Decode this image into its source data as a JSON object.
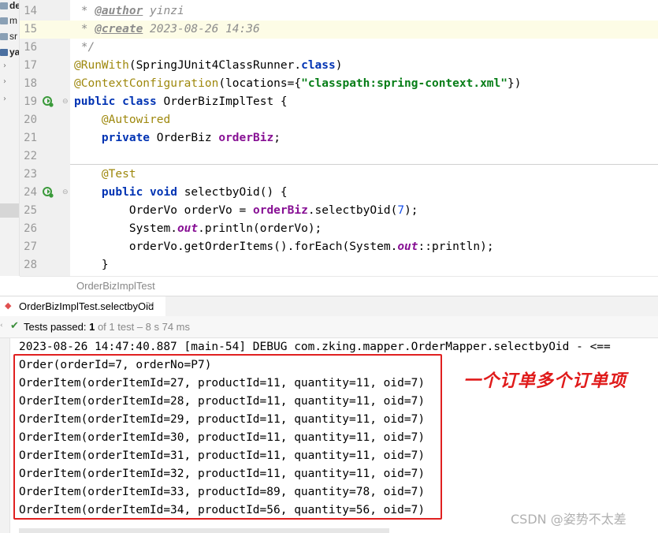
{
  "project_tree": {
    "items": [
      "de",
      "m",
      "sr",
      "ya"
    ]
  },
  "editor": {
    "lines": [
      {
        "n": "14",
        "tokens": [
          {
            "t": " * ",
            "c": "cm"
          },
          {
            "t": "@author",
            "c": "tag"
          },
          {
            "t": " yinzi",
            "c": "cm"
          }
        ]
      },
      {
        "n": "15",
        "hl": true,
        "tokens": [
          {
            "t": " * ",
            "c": "cm"
          },
          {
            "t": "@create",
            "c": "tag"
          },
          {
            "t": " 2023-08-26 14:36",
            "c": "cm"
          }
        ]
      },
      {
        "n": "16",
        "tokens": [
          {
            "t": " */",
            "c": "cm"
          }
        ]
      },
      {
        "n": "17",
        "tokens": [
          {
            "t": "@RunWith",
            "c": "ann"
          },
          {
            "t": "(SpringJUnit4ClassRunner.",
            "c": ""
          },
          {
            "t": "class",
            "c": "kw"
          },
          {
            "t": ")",
            "c": ""
          }
        ]
      },
      {
        "n": "18",
        "tokens": [
          {
            "t": "@ContextConfiguration",
            "c": "ann"
          },
          {
            "t": "(locations={",
            "c": ""
          },
          {
            "t": "\"classpath:spring-context.xml\"",
            "c": "str"
          },
          {
            "t": "})",
            "c": ""
          }
        ]
      },
      {
        "n": "19",
        "run": true,
        "tokens": [
          {
            "t": "public class ",
            "c": "kw"
          },
          {
            "t": "OrderBizImplTest {",
            "c": ""
          }
        ]
      },
      {
        "n": "20",
        "tokens": [
          {
            "t": "    ",
            "c": ""
          },
          {
            "t": "@Autowired",
            "c": "ann"
          }
        ]
      },
      {
        "n": "21",
        "tokens": [
          {
            "t": "    ",
            "c": ""
          },
          {
            "t": "private ",
            "c": "kw"
          },
          {
            "t": "OrderBiz ",
            "c": ""
          },
          {
            "t": "orderBiz",
            "c": "fld"
          },
          {
            "t": ";",
            "c": ""
          }
        ]
      },
      {
        "n": "22",
        "tokens": []
      },
      {
        "n": "23",
        "tokens": [
          {
            "t": "    ",
            "c": ""
          },
          {
            "t": "@Test",
            "c": "ann"
          }
        ]
      },
      {
        "n": "24",
        "run": true,
        "tokens": [
          {
            "t": "    ",
            "c": ""
          },
          {
            "t": "public void ",
            "c": "kw"
          },
          {
            "t": "selectbyOid() {",
            "c": ""
          }
        ]
      },
      {
        "n": "25",
        "tokens": [
          {
            "t": "        OrderVo orderVo = ",
            "c": ""
          },
          {
            "t": "orderBiz",
            "c": "fld"
          },
          {
            "t": ".selectbyOid(",
            "c": ""
          },
          {
            "t": "7",
            "c": "num"
          },
          {
            "t": ");",
            "c": ""
          }
        ]
      },
      {
        "n": "26",
        "tokens": [
          {
            "t": "        System.",
            "c": ""
          },
          {
            "t": "out",
            "c": "sfld"
          },
          {
            "t": ".println(orderVo);",
            "c": ""
          }
        ]
      },
      {
        "n": "27",
        "tokens": [
          {
            "t": "        orderVo.getOrderItems().forEach(System.",
            "c": ""
          },
          {
            "t": "out",
            "c": "sfld"
          },
          {
            "t": "::println);",
            "c": ""
          }
        ]
      },
      {
        "n": "28",
        "tokens": [
          {
            "t": "    }",
            "c": ""
          }
        ]
      }
    ]
  },
  "breadcrumb": {
    "label": "OrderBizImplTest"
  },
  "run_tab": {
    "label": "OrderBizImplTest.selectbyOid",
    "close": "×"
  },
  "status": {
    "passed": "Tests passed: ",
    "count": "1",
    "of_text": " of 1 test – 8 s 74 ms"
  },
  "console": {
    "log_line": "2023-08-26 14:47:40.887 [main-54] DEBUG com.zking.mapper.OrderMapper.selectbyOid - <==",
    "output": [
      "Order(orderId=7, orderNo=P7)",
      "OrderItem(orderItemId=27, productId=11, quantity=11, oid=7)",
      "OrderItem(orderItemId=28, productId=11, quantity=11, oid=7)",
      "OrderItem(orderItemId=29, productId=11, quantity=11, oid=7)",
      "OrderItem(orderItemId=30, productId=11, quantity=11, oid=7)",
      "OrderItem(orderItemId=31, productId=11, quantity=11, oid=7)",
      "OrderItem(orderItemId=32, productId=11, quantity=11, oid=7)",
      "OrderItem(orderItemId=33, productId=89, quantity=78, oid=7)",
      "OrderItem(orderItemId=34, productId=56, quantity=56, oid=7)"
    ]
  },
  "annotation": {
    "note": "一个订单多个订单项",
    "color": "#e01b1b"
  },
  "watermark": "CSDN @姿势不太差"
}
